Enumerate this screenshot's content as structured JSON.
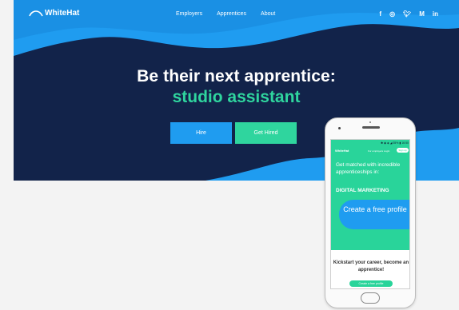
{
  "brand": {
    "name": "WhiteHat",
    "logo_icon": "whitehat-logo-icon"
  },
  "nav": {
    "links": [
      "Employers",
      "Apprentices",
      "About"
    ]
  },
  "social": [
    {
      "icon": "facebook-icon",
      "glyph": "f"
    },
    {
      "icon": "instagram-icon",
      "glyph": "◎"
    },
    {
      "icon": "twitter-icon",
      "glyph": "🐦︎"
    },
    {
      "icon": "medium-icon",
      "glyph": "M"
    },
    {
      "icon": "linkedin-icon",
      "glyph": "in"
    }
  ],
  "hero": {
    "title": "Be their next apprentice:",
    "subtitle": "studio assistant",
    "hire_label": "Hire",
    "get_hired_label": "Get Hired"
  },
  "phone": {
    "status": "✱ ◉ ◈ ◢ 35% ▮ 16:50",
    "logo": "WhiteHat",
    "nav_links": "For employers   Login",
    "signup": "Sign up",
    "headline": "Get matched with incredible apprenticeships in:",
    "discipline": "DIGITAL MARKETING",
    "cta": "Create a free profile",
    "footer": "Kickstart your career, become an apprentice!",
    "footer_button": "Create a free profile"
  },
  "colors": {
    "navy": "#12234a",
    "blue": "#1f9cf0",
    "green": "#2fd59e"
  }
}
